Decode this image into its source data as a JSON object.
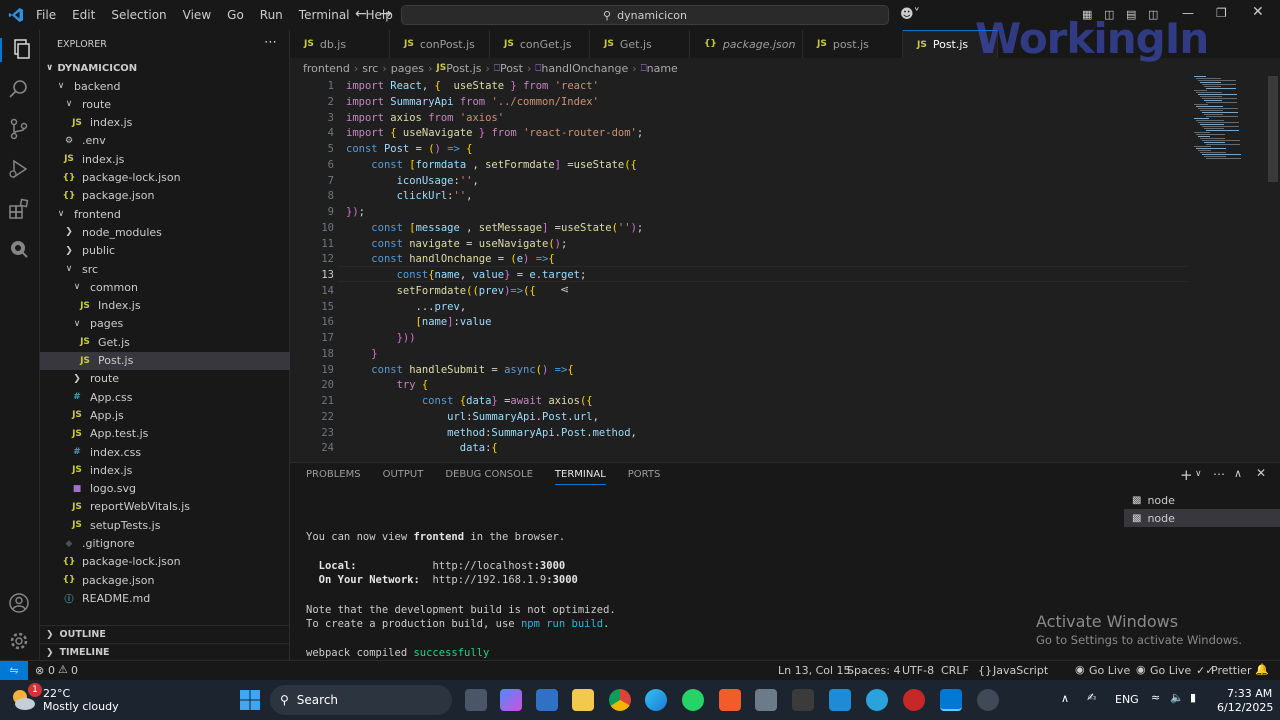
{
  "titlebar": {
    "menus": [
      "File",
      "Edit",
      "Selection",
      "View",
      "Go",
      "Run",
      "Terminal",
      "Help"
    ],
    "search_text": "dynamicicon"
  },
  "explorer": {
    "title": "EXPLORER",
    "root": "DYNAMICICON",
    "items": [
      {
        "label": "backend",
        "type": "folder-open",
        "indent": 1
      },
      {
        "label": "route",
        "type": "folder-open",
        "indent": 2
      },
      {
        "label": "index.js",
        "type": "js",
        "indent": 3
      },
      {
        "label": ".env",
        "type": "gear",
        "indent": 2
      },
      {
        "label": "index.js",
        "type": "js",
        "indent": 2
      },
      {
        "label": "package-lock.json",
        "type": "json",
        "indent": 2
      },
      {
        "label": "package.json",
        "type": "json",
        "indent": 2
      },
      {
        "label": "frontend",
        "type": "folder-open",
        "indent": 1
      },
      {
        "label": "node_modules",
        "type": "folder",
        "indent": 2
      },
      {
        "label": "public",
        "type": "folder",
        "indent": 2
      },
      {
        "label": "src",
        "type": "folder-open",
        "indent": 2
      },
      {
        "label": "common",
        "type": "folder-open",
        "indent": 3
      },
      {
        "label": "Index.js",
        "type": "js",
        "indent": 4
      },
      {
        "label": "pages",
        "type": "folder-open",
        "indent": 3
      },
      {
        "label": "Get.js",
        "type": "js",
        "indent": 4
      },
      {
        "label": "Post.js",
        "type": "js",
        "indent": 4,
        "selected": true
      },
      {
        "label": "route",
        "type": "folder",
        "indent": 3
      },
      {
        "label": "App.css",
        "type": "css",
        "indent": 3
      },
      {
        "label": "App.js",
        "type": "js",
        "indent": 3
      },
      {
        "label": "App.test.js",
        "type": "js",
        "indent": 3
      },
      {
        "label": "index.css",
        "type": "css",
        "indent": 3
      },
      {
        "label": "index.js",
        "type": "js",
        "indent": 3
      },
      {
        "label": "logo.svg",
        "type": "svg",
        "indent": 3
      },
      {
        "label": "reportWebVitals.js",
        "type": "js",
        "indent": 3
      },
      {
        "label": "setupTests.js",
        "type": "js",
        "indent": 3
      },
      {
        "label": ".gitignore",
        "type": "git",
        "indent": 2
      },
      {
        "label": "package-lock.json",
        "type": "json",
        "indent": 2
      },
      {
        "label": "package.json",
        "type": "json",
        "indent": 2
      },
      {
        "label": "README.md",
        "type": "md",
        "indent": 2
      }
    ],
    "outline": "OUTLINE",
    "timeline": "TIMELINE"
  },
  "tabs": [
    {
      "label": "db.js",
      "icon": "JS"
    },
    {
      "label": "conPost.js",
      "icon": "JS"
    },
    {
      "label": "conGet.js",
      "icon": "JS"
    },
    {
      "label": "Get.js",
      "icon": "JS"
    },
    {
      "label": "package.json",
      "icon": "{}"
    },
    {
      "label": "post.js",
      "icon": "JS"
    },
    {
      "label": "Post.js",
      "icon": "JS",
      "active": true
    }
  ],
  "breadcrumb": [
    "frontend",
    "src",
    "pages",
    "Post.js",
    "Post",
    "handlOnchange",
    "name"
  ],
  "code_lines": [
    "import React, {  useState } from 'react'",
    "import SummaryApi from '../common/Index'",
    "import axios from 'axios'",
    "import { useNavigate } from 'react-router-dom';",
    "const Post = () => {",
    "    const [formdata , setFormdate] =useState({",
    "        iconUsage:'',",
    "        clickUrl:'',",
    "});",
    "    const [message , setMessage] =useState('');",
    "    const navigate = useNavigate();",
    "    const handlOnchange = (e) =>{",
    "        const{name, value} = e.target;",
    "        setFormdate((prev)=>({",
    "           ...prev,",
    "           [name]:value",
    "        }))",
    "    }",
    "    const handleSubmit = async() =>{",
    "        try {",
    "            const {data} =await axios({",
    "                url:SummaryApi.Post.url,",
    "                method:SummaryApi.Post.method,",
    "                  data:{"
  ],
  "current_line": 13,
  "panel": {
    "tabs": [
      "PROBLEMS",
      "OUTPUT",
      "DEBUG CONSOLE",
      "TERMINAL",
      "PORTS"
    ],
    "active_tab": "TERMINAL",
    "terminal_lines": [
      "",
      "You can now view frontend in the browser.",
      "",
      "  Local:            http://localhost:3000",
      "  On Your Network:  http://192.168.1.9:3000",
      "",
      "Note that the development build is not optimized.",
      "To create a production build, use npm run build.",
      "",
      "webpack compiled successfully"
    ],
    "terminal_list": [
      "node",
      "node"
    ]
  },
  "statusbar": {
    "problems": "0",
    "warnings": "0",
    "position": "Ln 13, Col 15",
    "spaces": "Spaces: 4",
    "encoding": "UTF-8",
    "eol": "CRLF",
    "language": "JavaScript",
    "golive1": "Go Live",
    "golive2": "Go Live",
    "prettier": "Prettier"
  },
  "activate": {
    "title": "Activate Windows",
    "subtitle": "Go to Settings to activate Windows."
  },
  "taskbar": {
    "weather_temp": "22°C",
    "weather_desc": "Mostly cloudy",
    "search": "Search",
    "lang": "ENG",
    "time": "7:33 AM",
    "date": "6/12/2025",
    "notification_count": "1"
  },
  "watermark": "WorkingIn",
  "colors": {
    "accent": "#0078d4",
    "js_icon": "#cbcb41",
    "json_icon": "#cbcb41",
    "css_icon": "#519aba",
    "success": "#23d18b"
  }
}
